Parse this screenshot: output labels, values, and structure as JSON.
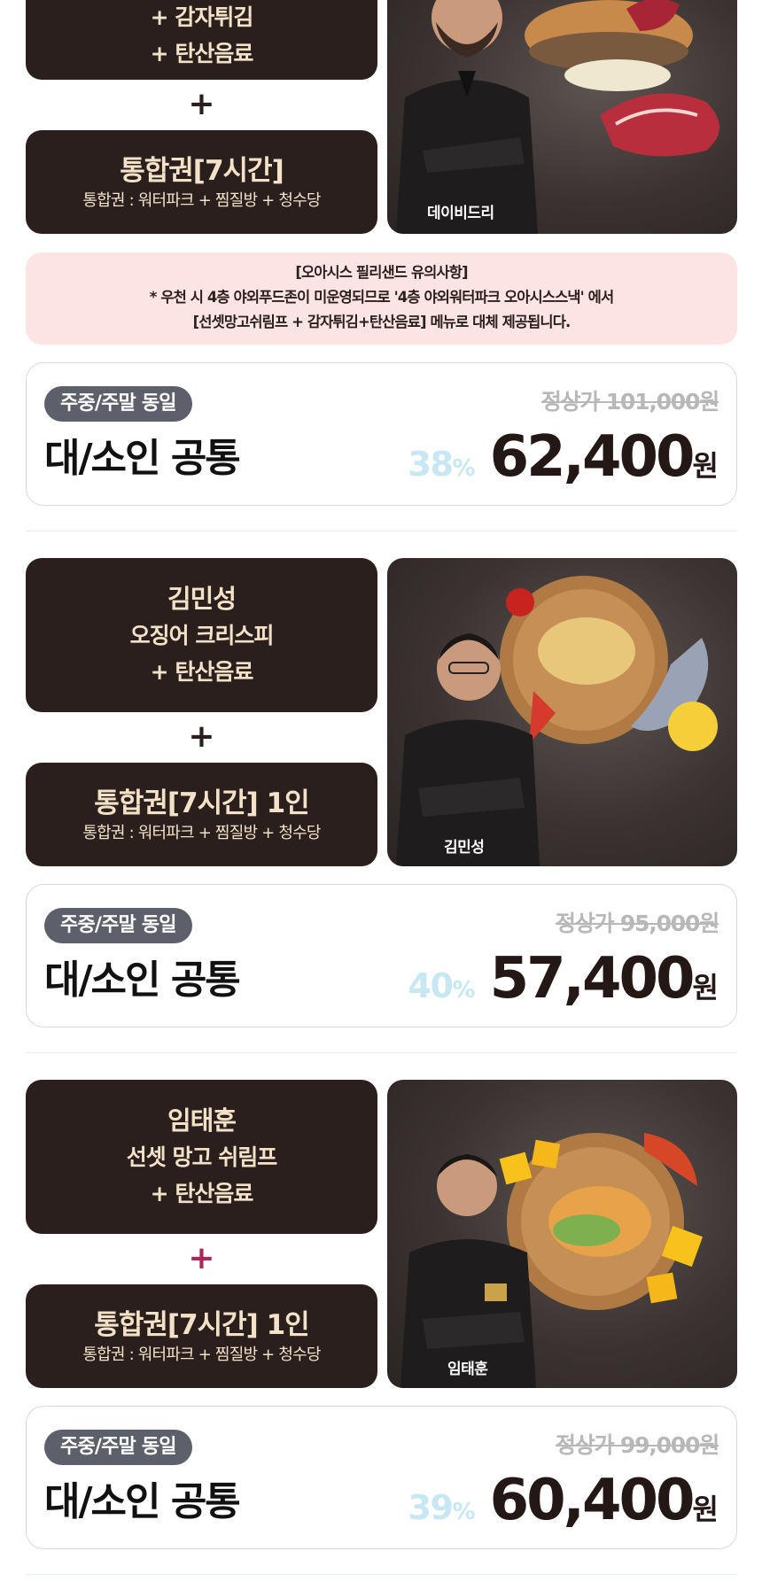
{
  "section1": {
    "menu_lines": [
      "+ 감자튀김",
      "+ 탄산음료"
    ],
    "pass_title": "통합권[7시간]",
    "pass_sub": "통합권 : 워터파크 + 찜질방 + 청수당",
    "chef_label": "데이비드리",
    "notice_lines": [
      "[오아시스 필리샌드 유의사항]",
      "* 우천 시 4층 야외푸드존이 미운영되므로 '4층 야외워터파크 오아시스스낵' 에서",
      "[선셋망고쉬림프 + 감자튀김+탄산음료] 메뉴로 대체 제공됩니다."
    ],
    "badge": "주중/주말 동일",
    "target": "대/소인 공통",
    "regular_price": "정상가 101,000원",
    "discount_num": "38",
    "discount_unit": "%",
    "price_num": "62,400",
    "price_unit": "원"
  },
  "section2": {
    "chef_name": "김민성",
    "menu_lines": [
      "오징어 크리스피",
      "+ 탄산음료"
    ],
    "plus": "+",
    "pass_title": "통합권[7시간] 1인",
    "pass_sub": "통합권 : 워터파크 + 찜질방 + 청수당",
    "chef_label": "김민성",
    "badge": "주중/주말 동일",
    "target": "대/소인 공통",
    "regular_price": "정상가 95,000원",
    "discount_num": "40",
    "discount_unit": "%",
    "price_num": "57,400",
    "price_unit": "원"
  },
  "section3": {
    "chef_name": "임태훈",
    "menu_lines": [
      "선셋 망고 쉬림프",
      "+ 탄산음료"
    ],
    "plus": "+",
    "pass_title": "통합권[7시간] 1인",
    "pass_sub": "통합권 : 워터파크 + 찜질방 + 청수당",
    "chef_label": "임태훈",
    "badge": "주중/주말 동일",
    "target": "대/소인 공통",
    "regular_price": "정상가 99,000원",
    "discount_num": "39",
    "discount_unit": "%",
    "price_num": "60,400",
    "price_unit": "원"
  },
  "plus_symbol": "+",
  "colors": {
    "card_bg": "#2a1f1c",
    "card_text": "#f3e1c8",
    "notice_bg": "#fde4e4",
    "badge_bg": "#5d5f6b",
    "discount": "#c7e7f2",
    "plus_accent": "#b0245c"
  }
}
